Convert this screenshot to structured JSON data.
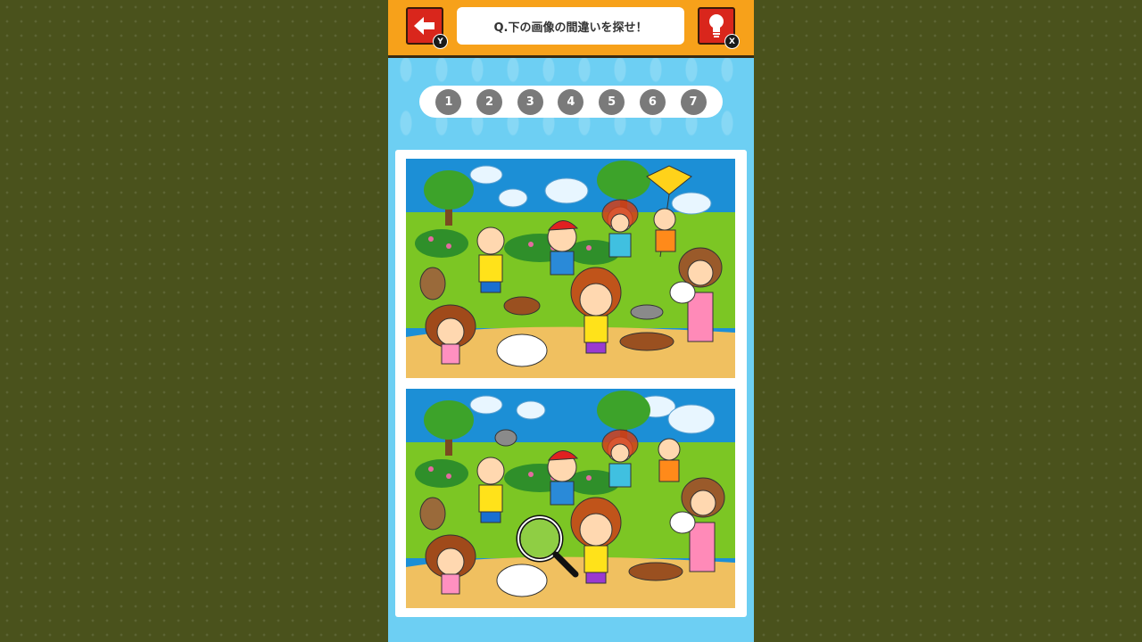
{
  "header": {
    "question": "Q.下の画像の間違いを探せ！",
    "back_key": "Y",
    "hint_key": "X",
    "back_icon": "arrow-left-icon",
    "hint_icon": "lightbulb-icon"
  },
  "progress": {
    "dots": [
      "1",
      "2",
      "3",
      "4",
      "5",
      "6",
      "7"
    ],
    "found_count": 0
  },
  "colors": {
    "background": "#4a521c",
    "panel": "#6dcff3",
    "topbar": "#f7a11a",
    "button": "#d9261c",
    "dot": "#7a7a7a"
  },
  "scenes": {
    "top": "original-picture",
    "bottom": "altered-picture"
  }
}
